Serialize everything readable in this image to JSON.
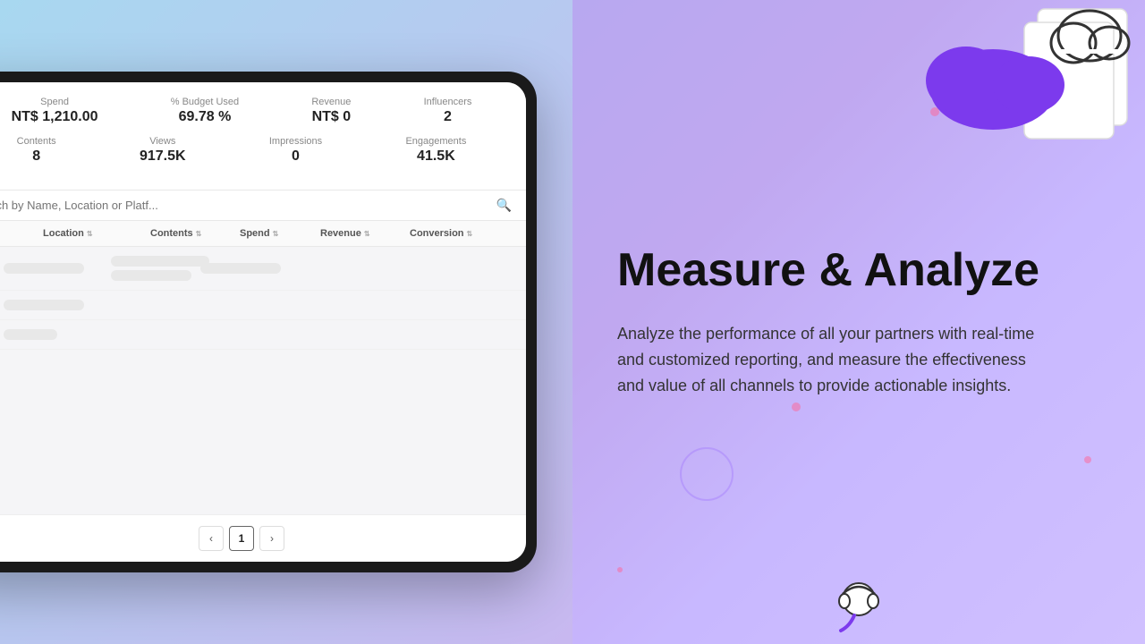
{
  "left": {
    "stats": {
      "row1": [
        {
          "label": "Spend",
          "value": "NT$ 1,210.00"
        },
        {
          "label": "% Budget Used",
          "value": "69.78 %"
        },
        {
          "label": "Revenue",
          "value": "NT$ 0"
        },
        {
          "label": "Influencers",
          "value": "2"
        }
      ],
      "row2": [
        {
          "label": "Contents",
          "value": "8"
        },
        {
          "label": "Views",
          "value": "917.5K"
        },
        {
          "label": "Impressions",
          "value": "0"
        },
        {
          "label": "Engagements",
          "value": "41.5K"
        }
      ]
    },
    "search": {
      "placeholder": "Search by Name, Location or Platf..."
    },
    "table": {
      "columns": [
        "",
        "Location",
        "Contents",
        "Spend",
        "Revenue",
        "Conversion"
      ],
      "pagination": {
        "prev": "‹",
        "page": "1",
        "next": "›"
      }
    }
  },
  "right": {
    "title": "Measure & Analyze",
    "description": "Analyze the performance of all your partners with real-time and customized reporting, and measure the effectiveness and value of all channels to provide actionable insights."
  }
}
